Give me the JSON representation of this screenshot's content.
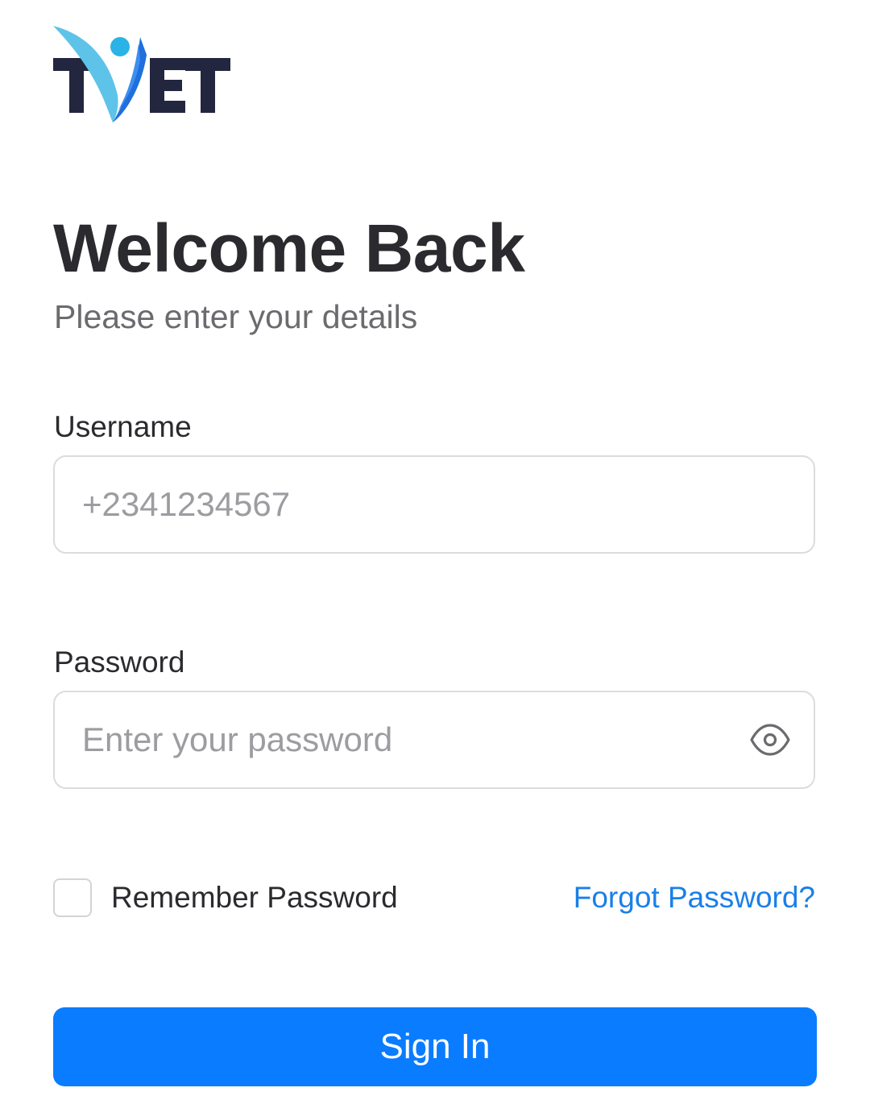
{
  "brand": {
    "logo_text": "TYET",
    "colors": {
      "navy": "#23263f",
      "blue": "#1a7fe8",
      "cyan": "#2ab3e6"
    }
  },
  "header": {
    "title": "Welcome Back",
    "subtitle": "Please enter your details"
  },
  "form": {
    "username": {
      "label": "Username",
      "placeholder": "+2341234567",
      "value": ""
    },
    "password": {
      "label": "Password",
      "placeholder": "Enter your password",
      "value": "",
      "toggle_icon": "eye-icon"
    },
    "remember": {
      "label": "Remember Password",
      "checked": false
    },
    "forgot_link": "Forgot Password?",
    "submit_label": "Sign In"
  },
  "theme": {
    "accent": "#0a7cff",
    "link": "#1a7fe8",
    "text_primary": "#2b2b2f",
    "text_secondary": "#6b6b6f",
    "border": "#dcdce0"
  }
}
